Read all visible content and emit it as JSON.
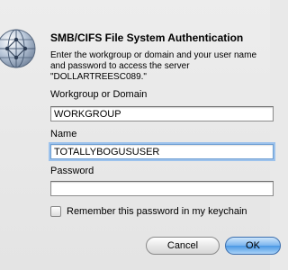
{
  "dialog": {
    "title": "SMB/CIFS File System Authentication",
    "description": "Enter the workgroup or domain and your user name\nand password to access the server\n\"DOLLARTREESC089.\"",
    "icon": "network-globe-icon"
  },
  "form": {
    "workgroup_label": "Workgroup or Domain",
    "workgroup_value": "WORKGROUP",
    "name_label": "Name",
    "name_value": "TOTALLYBOGUSUSER",
    "password_label": "Password",
    "password_value": "",
    "remember_label": "Remember this password in my keychain",
    "remember_checked": false
  },
  "buttons": {
    "cancel_label": "Cancel",
    "ok_label": "OK"
  },
  "colors": {
    "default_button": "#4a98e4",
    "focus_ring": "#9cc2ec"
  }
}
